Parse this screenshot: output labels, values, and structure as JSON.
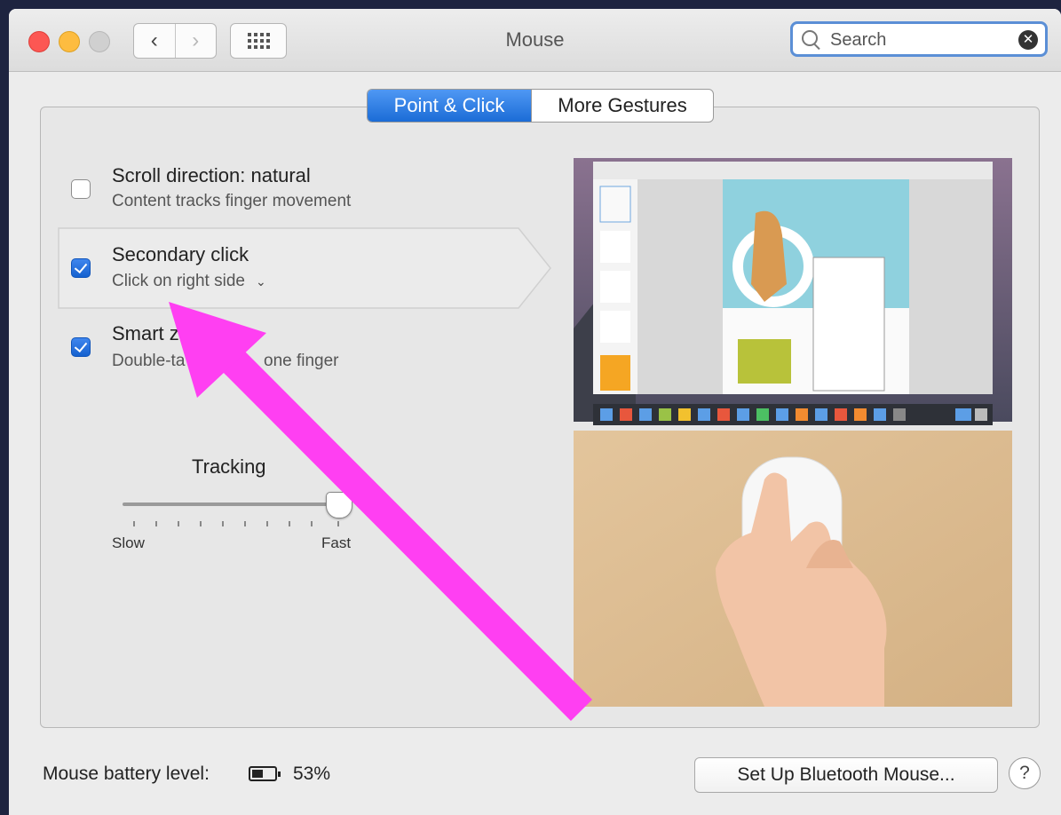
{
  "window": {
    "title": "Mouse"
  },
  "toolbar": {
    "back_label": "‹",
    "forward_label": "›"
  },
  "search": {
    "placeholder": "Search",
    "clear_icon": "✕"
  },
  "tabs": [
    {
      "label": "Point & Click",
      "active": true
    },
    {
      "label": "More Gestures",
      "active": false
    }
  ],
  "options": [
    {
      "title": "Scroll direction: natural",
      "subtitle": "Content tracks finger movement",
      "checked": false
    },
    {
      "title": "Secondary click",
      "subtitle": "Click on right side",
      "checked": true,
      "selected": true
    },
    {
      "title": "Smart z",
      "subtitle": "Double-ta",
      "subtitle_tail": "one finger",
      "checked": true
    }
  ],
  "tracking": {
    "label": "Tracking",
    "min_label": "Slow",
    "max_label": "Fast",
    "value_fraction": 1.0
  },
  "battery": {
    "label": "Mouse battery level:",
    "percent": "53%"
  },
  "buttons": {
    "setup": "Set Up Bluetooth Mouse...",
    "help": "?"
  },
  "colors": {
    "accent": "#1b6cd6",
    "annotation_arrow": "#ff3ff2"
  }
}
